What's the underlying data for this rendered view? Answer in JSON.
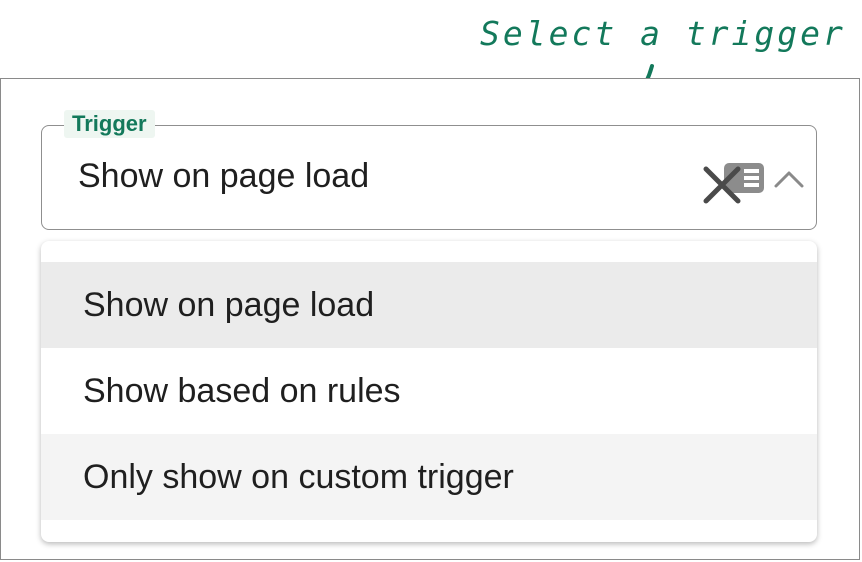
{
  "annotation": {
    "text": "Select a trigger",
    "color": "#13795b"
  },
  "trigger_field": {
    "label": "Trigger",
    "value": "Show on page load",
    "icons": [
      "clear-icon",
      "list-icon",
      "chevron-up-icon"
    ]
  },
  "dropdown": {
    "options": [
      {
        "label": "Show on page load",
        "selected": true
      },
      {
        "label": "Show based on rules",
        "selected": false
      },
      {
        "label": "Only show on custom trigger",
        "selected": false
      }
    ]
  },
  "colors": {
    "accent": "#13795b",
    "label_bg": "#eef6f1",
    "selected_bg": "#ebebeb",
    "hover_bg": "#f4f4f4"
  }
}
